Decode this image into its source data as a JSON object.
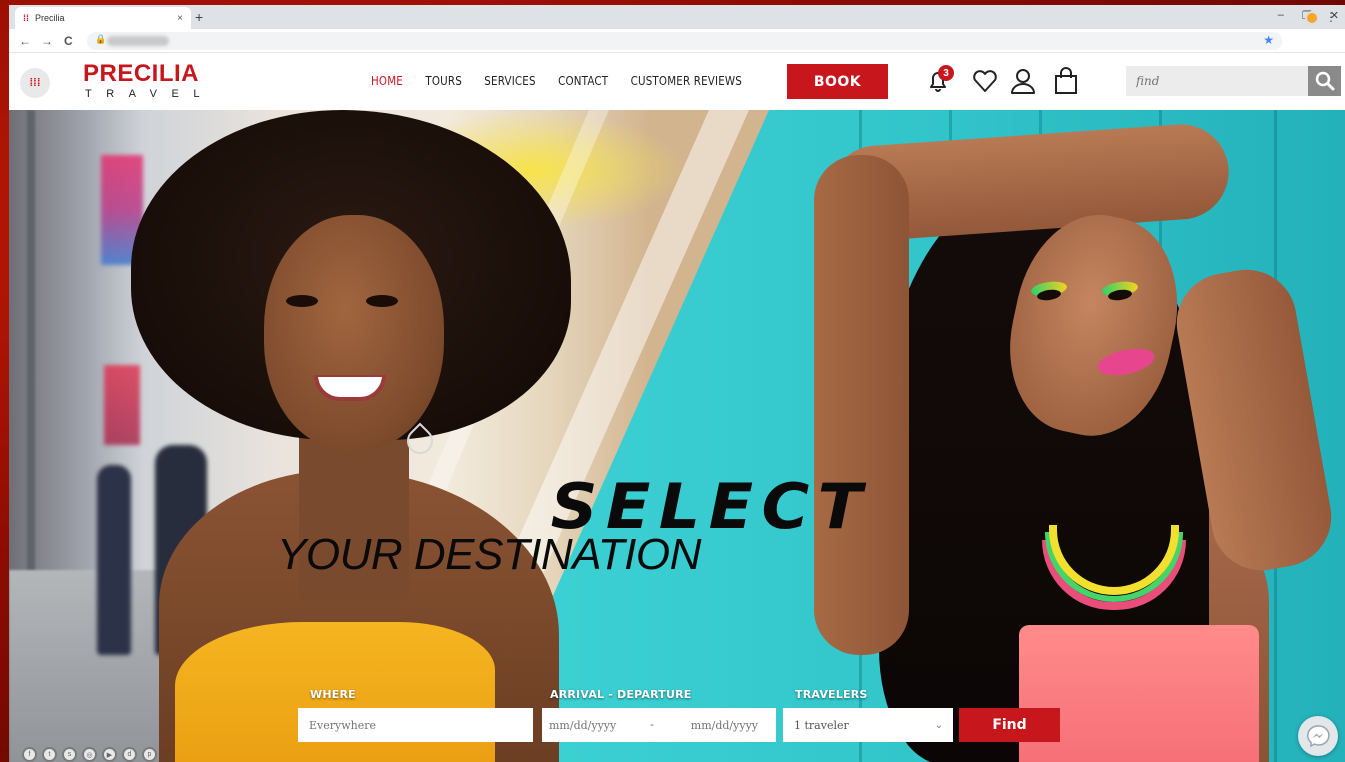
{
  "browser": {
    "tab_title": "Precilia",
    "tab_close": "×",
    "new_tab": "+",
    "window_controls": [
      "–",
      "❐",
      "✕"
    ],
    "nav": {
      "back": "←",
      "forward": "→",
      "reload": "C"
    }
  },
  "site": {
    "brand": "PRECILIA",
    "brand_sub": "TRAVEL",
    "menu": [
      {
        "label": "HOME",
        "active": true
      },
      {
        "label": "TOURS"
      },
      {
        "label": "SERVICES"
      },
      {
        "label": "CONTACT"
      },
      {
        "label": "CUSTOMER REVIEWS"
      }
    ],
    "book_label": "BOOK",
    "notification_count": "3",
    "search_placeholder": "find",
    "accent_color": "#c8161d"
  },
  "hero": {
    "headline_1": "SELECT",
    "headline_2": "YOUR DESTINATION"
  },
  "booking": {
    "where_label": "WHERE",
    "where_placeholder": "Everywhere",
    "dates_label": "ARRIVAL - DEPARTURE",
    "arrival_placeholder": "mm/dd/yyyy",
    "date_separator": "-",
    "departure_placeholder": "mm/dd/yyyy",
    "travelers_label": "TRAVELERS",
    "travelers_value": "1 traveler",
    "find_label": "Find"
  },
  "icons": [
    "grid-menu-icon",
    "bell-icon",
    "heart-icon",
    "user-icon",
    "bag-icon",
    "search-icon",
    "messenger-icon",
    "facebook-icon",
    "twitter-icon",
    "snapchat-icon",
    "instagram-icon",
    "youtube-icon",
    "deviantart-icon",
    "pinterest-icon"
  ]
}
